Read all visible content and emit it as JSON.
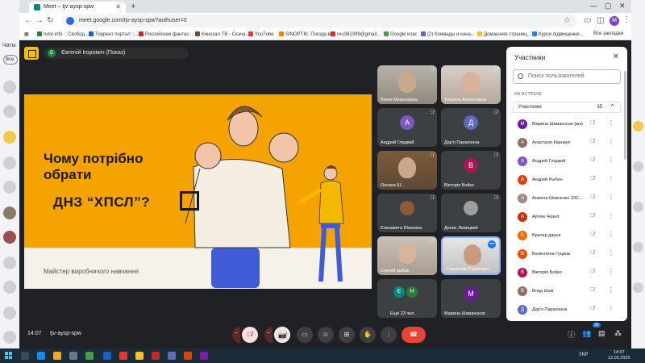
{
  "browser": {
    "tab_title": "Meet – tjv-aysp-spw",
    "url": "meet.google.com/tjv-aysp-spw?authuser=0",
    "profile_initial": "M",
    "bookmarks": [
      {
        "label": "rutor.info :: Свобод...",
        "color": "#2e7d32"
      },
      {
        "label": "Торрент портал ::...",
        "color": "#1565c0"
      },
      {
        "label": "Российская фантас...",
        "color": "#c62828"
      },
      {
        "label": "Кинозал.ТВ - Скача...",
        "color": "#6d4c41"
      },
      {
        "label": "YouTube",
        "color": "#e53935"
      },
      {
        "label": "SINOPTIK: Погода в...",
        "color": "#f57c00"
      },
      {
        "label": "reu382399@gmail...",
        "color": "#d32f2f"
      },
      {
        "label": "Google клас",
        "color": "#43a047"
      },
      {
        "label": "(2) Команды и кана...",
        "color": "#5c6bc0"
      },
      {
        "label": "Домашняя страниц...",
        "color": "#fbc02d"
      },
      {
        "label": "Курси підвищення...",
        "color": "#1e88e5"
      }
    ],
    "all_bookmarks": "Все закладки"
  },
  "left_rail": {
    "chats_label": "Чаты",
    "filter_label": "Все"
  },
  "presenter": {
    "initial": "Є",
    "label": "Євгеній Ігорович (Показ)"
  },
  "slide": {
    "title_line1": "Чому потрібно",
    "title_line2": "обрати",
    "title_line3": "ДНЗ “ХПСЛ”?",
    "footer": "Майстер виробничого навчання"
  },
  "tiles": [
    {
      "name": "Юлия Миколаївна",
      "type": "photo"
    },
    {
      "name": "Татьяна Анатоліївна",
      "type": "photo"
    },
    {
      "name": "Андрей Гладкий",
      "type": "avatar",
      "initial": "А",
      "color": "#7e57c2"
    },
    {
      "name": "Дар'я Парахонна",
      "type": "avatar",
      "initial": "Д",
      "color": "#5c6bc0"
    },
    {
      "name": "Оксана Ш...",
      "type": "photo"
    },
    {
      "name": "Вікторія Бойко",
      "type": "avatar",
      "initial": "В",
      "color": "#ad1457"
    },
    {
      "name": "Єлизавета Южаніна",
      "type": "photo"
    },
    {
      "name": "Денис Левицкий",
      "type": "photo"
    },
    {
      "name": "Сергей рыбак",
      "type": "photo"
    },
    {
      "name": "Станіслав Стратович",
      "type": "photo"
    },
    {
      "name": "Ещё 23 чел.",
      "type": "more",
      "initials": [
        "Є",
        "Н"
      ]
    },
    {
      "name": "Марина Шаманская",
      "type": "avatar",
      "initial": "М",
      "color": "#6a1b9a"
    }
  ],
  "panel": {
    "title": "Участники",
    "search_placeholder": "Поиск пользователей",
    "section": "НА ВСТРЕЧЕ",
    "group_label": "Участники",
    "group_count": "35",
    "people": [
      {
        "name": "Марина Шаманская (вы)",
        "initial": "М",
        "color": "#6a1b9a"
      },
      {
        "name": "Анастасія Карнаух",
        "initial": "А",
        "color": "#8d6e63"
      },
      {
        "name": "Андрей Гладкий",
        "initial": "А",
        "color": "#7e57c2"
      },
      {
        "name": "Андрей Рыбин",
        "initial": "А",
        "color": "#d84315"
      },
      {
        "name": "Анжела Шевченко 33С...",
        "initial": "А",
        "color": "#a1887f"
      },
      {
        "name": "Артём Черел",
        "initial": "А",
        "color": "#bf360c"
      },
      {
        "name": "Брыгар дарья",
        "initial": "Б",
        "color": "#ef6c00"
      },
      {
        "name": "Валентина Гуцина",
        "initial": "В",
        "color": "#e65100"
      },
      {
        "name": "Вікторія Бойко",
        "initial": "В",
        "color": "#ad1457"
      },
      {
        "name": "Влад Шум",
        "initial": "В",
        "color": "#8d6e63"
      },
      {
        "name": "Дар'я Парахонна",
        "initial": "Д",
        "color": "#5c6bc0"
      }
    ]
  },
  "bottom": {
    "time": "14:07",
    "meeting_code": "tjv-aysp-spw",
    "participants_badge": "35"
  },
  "taskbar": {
    "tray_lang": "УКР",
    "clock_time": "14:07",
    "clock_date": "12.03.2025"
  }
}
